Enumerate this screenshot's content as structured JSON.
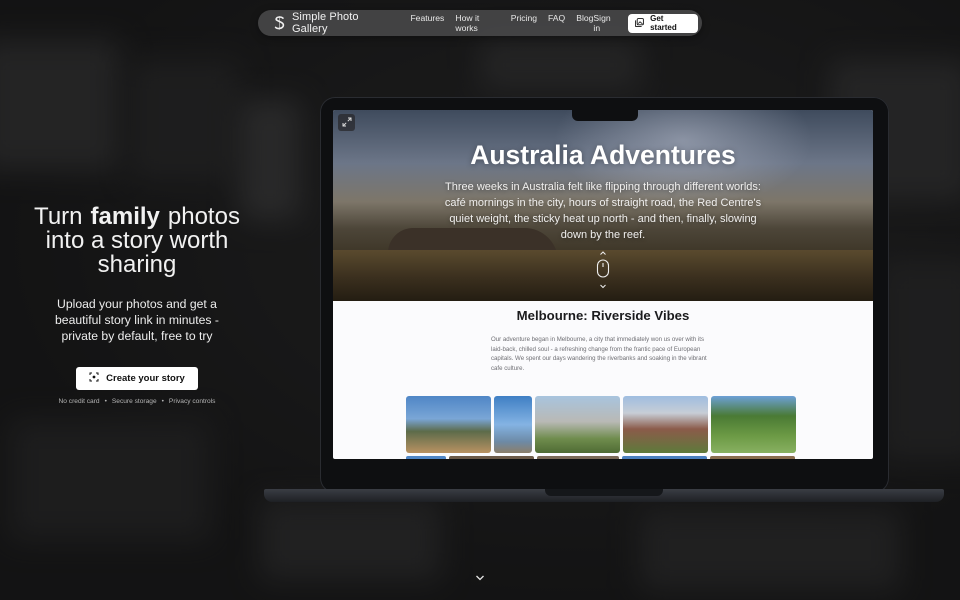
{
  "brand": {
    "name": "Simple Photo Gallery",
    "icon": "s-logo-icon"
  },
  "nav": {
    "links": [
      "Features",
      "How it works",
      "Pricing",
      "FAQ",
      "Blog"
    ],
    "signin": "Sign in",
    "cta": "Get started"
  },
  "hero": {
    "title_prefix": "Turn",
    "title_emphasis": "family",
    "title_rest": "photos into a story worth sharing",
    "subtitle": "Upload your photos and get a beautiful story link in minutes - private by default, free to try",
    "cta": "Create your story",
    "trust": [
      "No credit card",
      "•",
      "Secure storage",
      "•",
      "Privacy controls"
    ]
  },
  "preview": {
    "title": "Australia Adventures",
    "intro": "Three weeks in Australia felt like flipping through different worlds: café mornings in the city, hours of straight road, the Red Centre's quiet weight, the sticky heat up north - and then, finally, slowing down by the reef.",
    "section_title": "Melbourne: Riverside Vibes",
    "section_body": "Our adventure began in Melbourne, a city that immediately won us over with its laid-back, chilled soul - a refreshing change from the frantic pace of European capitals. We spent our days wandering the riverbanks and soaking in the vibrant cafe culture.",
    "photos": [
      {
        "name": "photo-yarra-river",
        "colors": [
          "#4f86c6",
          "#7aa6d6",
          "#5c6b4a",
          "#b99262"
        ]
      },
      {
        "name": "photo-arts-spire",
        "colors": [
          "#3f7fc4",
          "#84b3e3",
          "#6d8aa6",
          "#8c7f6a"
        ]
      },
      {
        "name": "photo-glass-building",
        "colors": [
          "#a8c4de",
          "#b9b9b5",
          "#6f8c4d",
          "#4f6b34"
        ]
      },
      {
        "name": "photo-exhibition-building",
        "colors": [
          "#9fbde0",
          "#c7cdd6",
          "#8b5b4a",
          "#5e7a3b"
        ]
      },
      {
        "name": "photo-garden-trees",
        "colors": [
          "#6da0d6",
          "#4a7a34",
          "#6c9a45",
          "#88b061"
        ]
      }
    ]
  }
}
